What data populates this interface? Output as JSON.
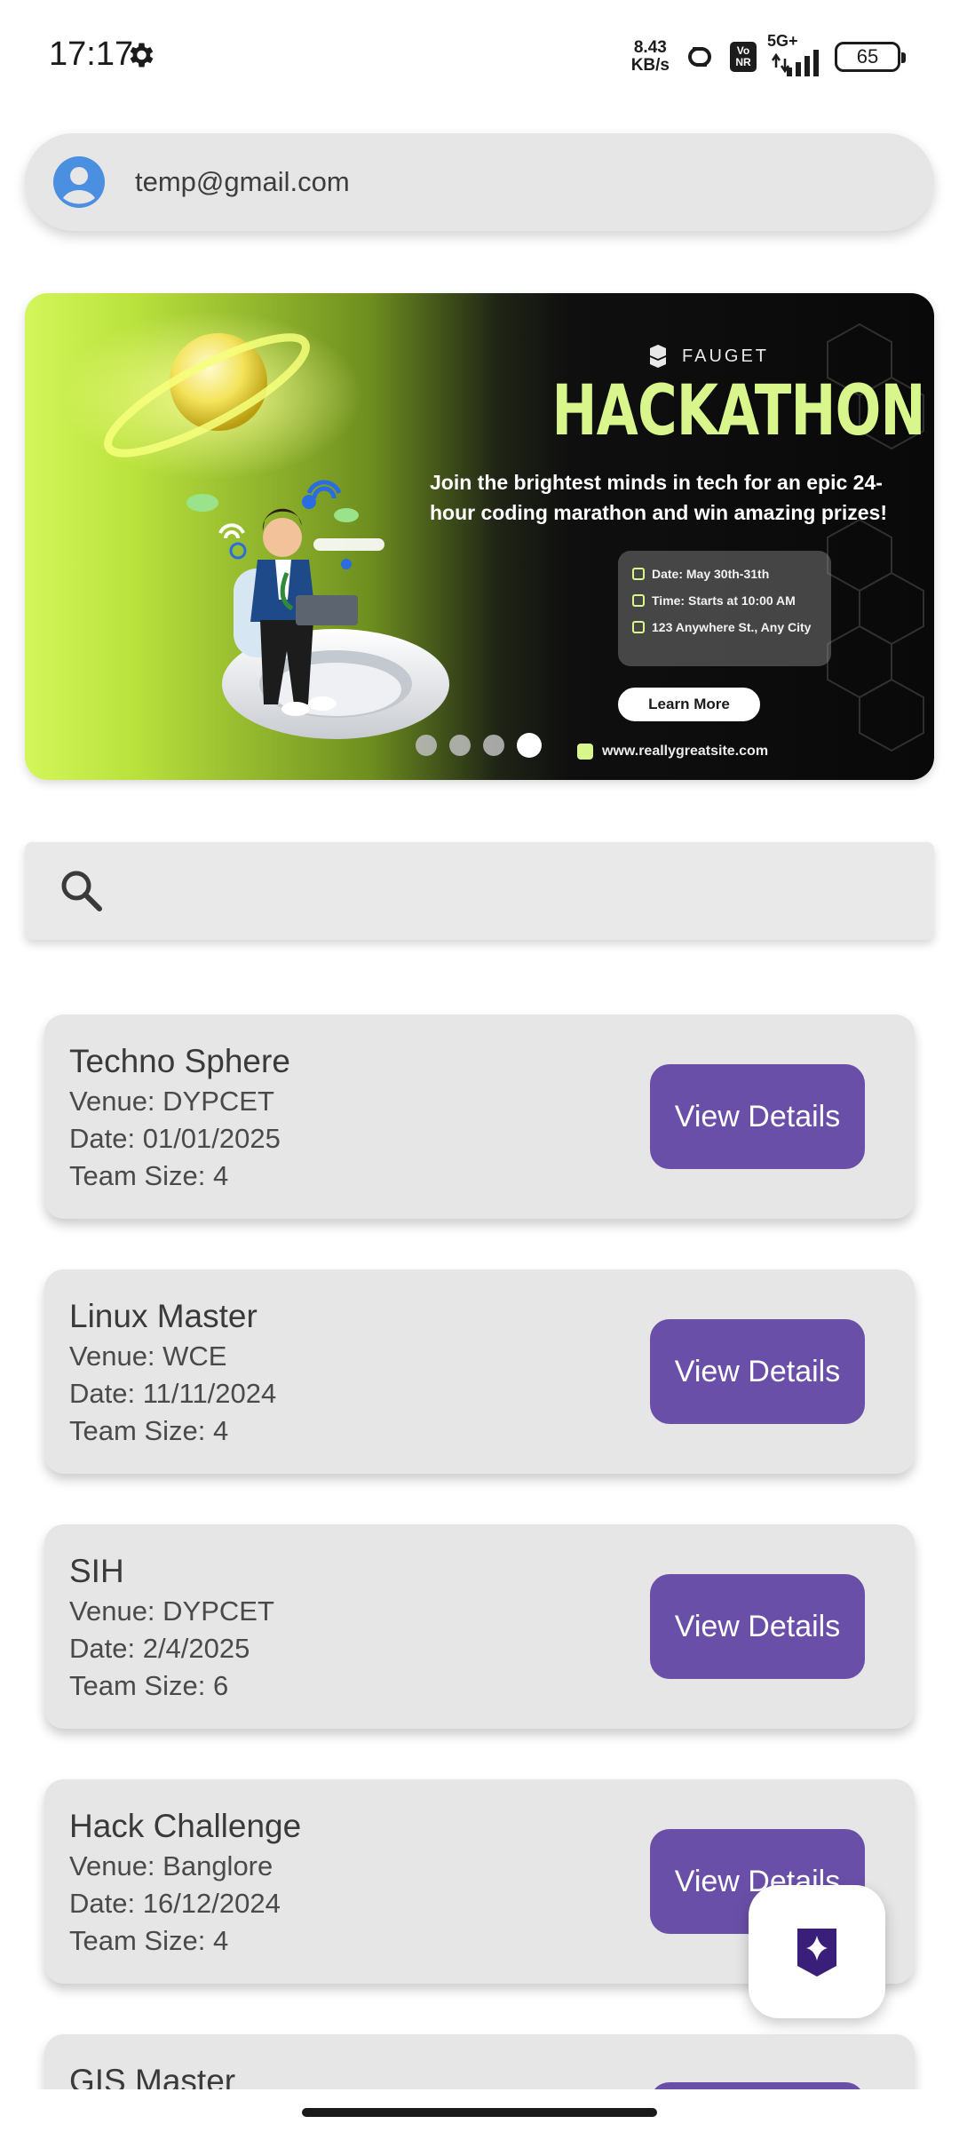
{
  "status_bar": {
    "time": "17:17",
    "net_speed_value": "8.43",
    "net_speed_unit": "KB/s",
    "volte_top": "Vo",
    "volte_bottom": "NR",
    "network_type": "5G+",
    "battery": "65"
  },
  "account": {
    "email": "temp@gmail.com"
  },
  "banner": {
    "brand": "FAUGET",
    "title": "HACKATHON",
    "tagline": "Join the brightest minds in tech for an epic 24-hour coding marathon and win amazing prizes!",
    "info": [
      "Date: May 30th-31th",
      "Time: Starts at 10:00 AM",
      "123 Anywhere St., Any City"
    ],
    "cta": "Learn More",
    "website": "www.reallygreatsite.com",
    "page_count": 4,
    "active_page": 4,
    "accent_color": "#d9f68c"
  },
  "search": {
    "placeholder": "",
    "value": ""
  },
  "events": [
    {
      "title": "Techno Sphere",
      "venue": "Venue: DYPCET",
      "date": "Date: 01/01/2025",
      "team": "Team Size: 4",
      "button": "View Details"
    },
    {
      "title": "Linux Master",
      "venue": "Venue: WCE",
      "date": "Date: 11/11/2024",
      "team": "Team Size: 4",
      "button": "View Details"
    },
    {
      "title": "SIH",
      "venue": "Venue: DYPCET",
      "date": "Date: 2/4/2025",
      "team": "Team Size: 6",
      "button": "View Details"
    },
    {
      "title": "Hack Challenge",
      "venue": "Venue: Banglore",
      "date": "Date: 16/12/2024",
      "team": "Team Size: 4",
      "button": "View Details"
    },
    {
      "title": "GIS Master",
      "venue": "",
      "date": "",
      "team": "",
      "button": ""
    }
  ],
  "colors": {
    "button": "#6a4fa8",
    "card": "#e6e6e6",
    "fab_icon": "#3a1f7a"
  },
  "icons": {
    "settings": "gear-icon",
    "avatar": "account-circle-icon",
    "search": "search-icon",
    "fab": "sparkle-icon"
  }
}
